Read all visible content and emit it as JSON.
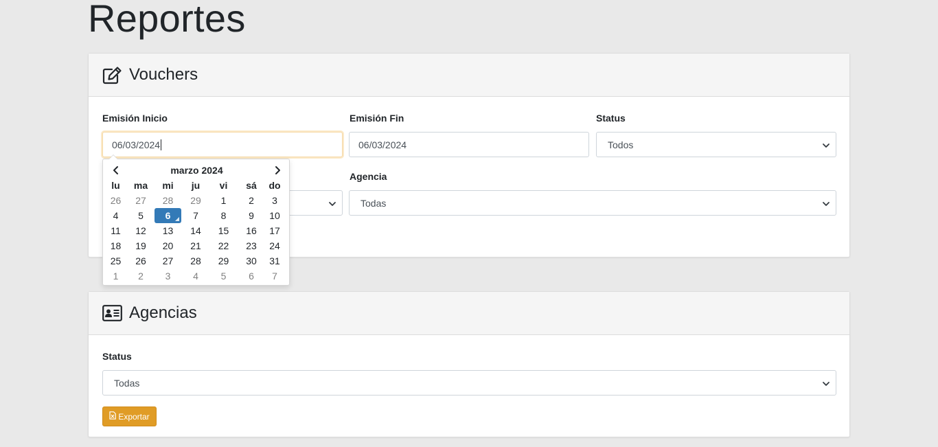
{
  "page": {
    "title": "Reportes"
  },
  "vouchers": {
    "header": "Vouchers",
    "emision_inicio_label": "Emisión Inicio",
    "emision_inicio_value": "06/03/2024",
    "emision_fin_label": "Emisión Fin",
    "emision_fin_value": "06/03/2024",
    "status_label": "Status",
    "status_value": "Todos",
    "agencia_label": "Agencia",
    "agencia_value": "Todas"
  },
  "datepicker": {
    "title": "marzo 2024",
    "weekdays": [
      "lu",
      "ma",
      "mi",
      "ju",
      "vi",
      "sá",
      "do"
    ],
    "weeks": [
      [
        "26",
        "27",
        "28",
        "29",
        "1",
        "2",
        "3"
      ],
      [
        "4",
        "5",
        "6",
        "7",
        "8",
        "9",
        "10"
      ],
      [
        "11",
        "12",
        "13",
        "14",
        "15",
        "16",
        "17"
      ],
      [
        "18",
        "19",
        "20",
        "21",
        "22",
        "23",
        "24"
      ],
      [
        "25",
        "26",
        "27",
        "28",
        "29",
        "30",
        "31"
      ],
      [
        "1",
        "2",
        "3",
        "4",
        "5",
        "6",
        "7"
      ]
    ],
    "muted": [
      [
        0,
        0
      ],
      [
        0,
        1
      ],
      [
        0,
        2
      ],
      [
        0,
        3
      ],
      [
        5,
        0
      ],
      [
        5,
        1
      ],
      [
        5,
        2
      ],
      [
        5,
        3
      ],
      [
        5,
        4
      ],
      [
        5,
        5
      ],
      [
        5,
        6
      ]
    ],
    "selected": [
      1,
      2
    ]
  },
  "agencias": {
    "header": "Agencias",
    "status_label": "Status",
    "status_value": "Todas",
    "export_label": "Exportar"
  },
  "icons": {
    "vouchers": "edit-icon",
    "agencias": "id-card-icon",
    "export": "file-excel-icon"
  },
  "colors": {
    "accent": "#e09c26",
    "selected_day": "#337ab7",
    "background": "#e9e9e9"
  }
}
